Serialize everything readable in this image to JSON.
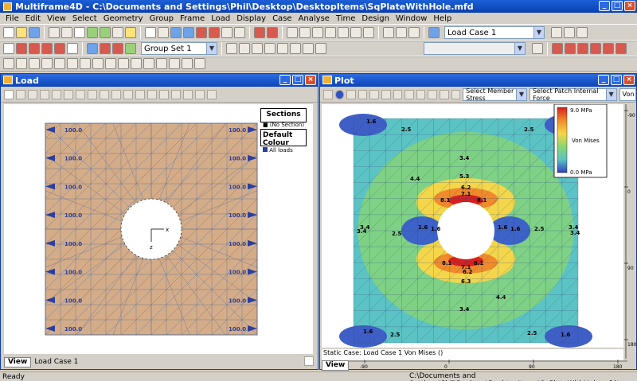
{
  "app": {
    "title": "Multiframe4D - C:\\Documents and Settings\\Phil\\Desktop\\DesktopItems\\SqPlateWithHole.mfd",
    "status": "Ready",
    "status_path": "C:\\Documents and Settings\\Phil\\Desktop\\DesktopItems\\SqPlateWithHole.mfd*"
  },
  "menu": [
    "File",
    "Edit",
    "View",
    "Select",
    "Geometry",
    "Group",
    "Frame",
    "Load",
    "Display",
    "Case",
    "Analyse",
    "Time",
    "Design",
    "Window",
    "Help"
  ],
  "toolbar": {
    "load_case": "Load Case 1",
    "group_set": "Group Set 1"
  },
  "load_window": {
    "title": "Load",
    "tab_view": "View",
    "tab_case": "Load Case 1",
    "load_value": "100.0",
    "sections_title": "Sections",
    "sections_item": "(No Section)",
    "colour_title": "Default Colour",
    "colour_item": "All loads",
    "axis_x": "x",
    "axis_z": "z"
  },
  "plot_window": {
    "title": "Plot",
    "member_stress": "Select Member Stress",
    "patch_force": "Select Patch Internal Force",
    "cut_label": "Von",
    "static_case": "Static Case: Load Case 1   Von Mises ()",
    "tab_view": "View",
    "legend_max": "9.0 MPa",
    "legend_min": "0.0 MPa",
    "legend_name": "Von Mises",
    "ruler_bottom": [
      "-90",
      "0",
      "90",
      "180"
    ],
    "ruler_right": [
      "-90",
      "0",
      "90",
      "180"
    ],
    "contour_labels": [
      "1.6",
      "2.5",
      "2.5",
      "1.6",
      "3.4",
      "4.4",
      "5.3",
      "6.2",
      "7.1",
      "8.1",
      "8.1",
      "3.4",
      "3.4",
      "2.5",
      "1.6",
      "1.6",
      "1.6",
      "1.6",
      "2.5",
      "3.4",
      "3.4",
      "8.1",
      "8.1",
      "7.1",
      "6.2",
      "6.3",
      "4.4",
      "3.4",
      "1.6",
      "2.5",
      "2.5",
      "1.6"
    ]
  },
  "colors": {
    "title_blue": "#0a3fb0",
    "plate_fill": "#d4ac88",
    "mesh": "#5b6f96",
    "load_arrow": "#2a3f9f",
    "stress_high": "#d81e1e",
    "stress_low": "#3050c8"
  }
}
